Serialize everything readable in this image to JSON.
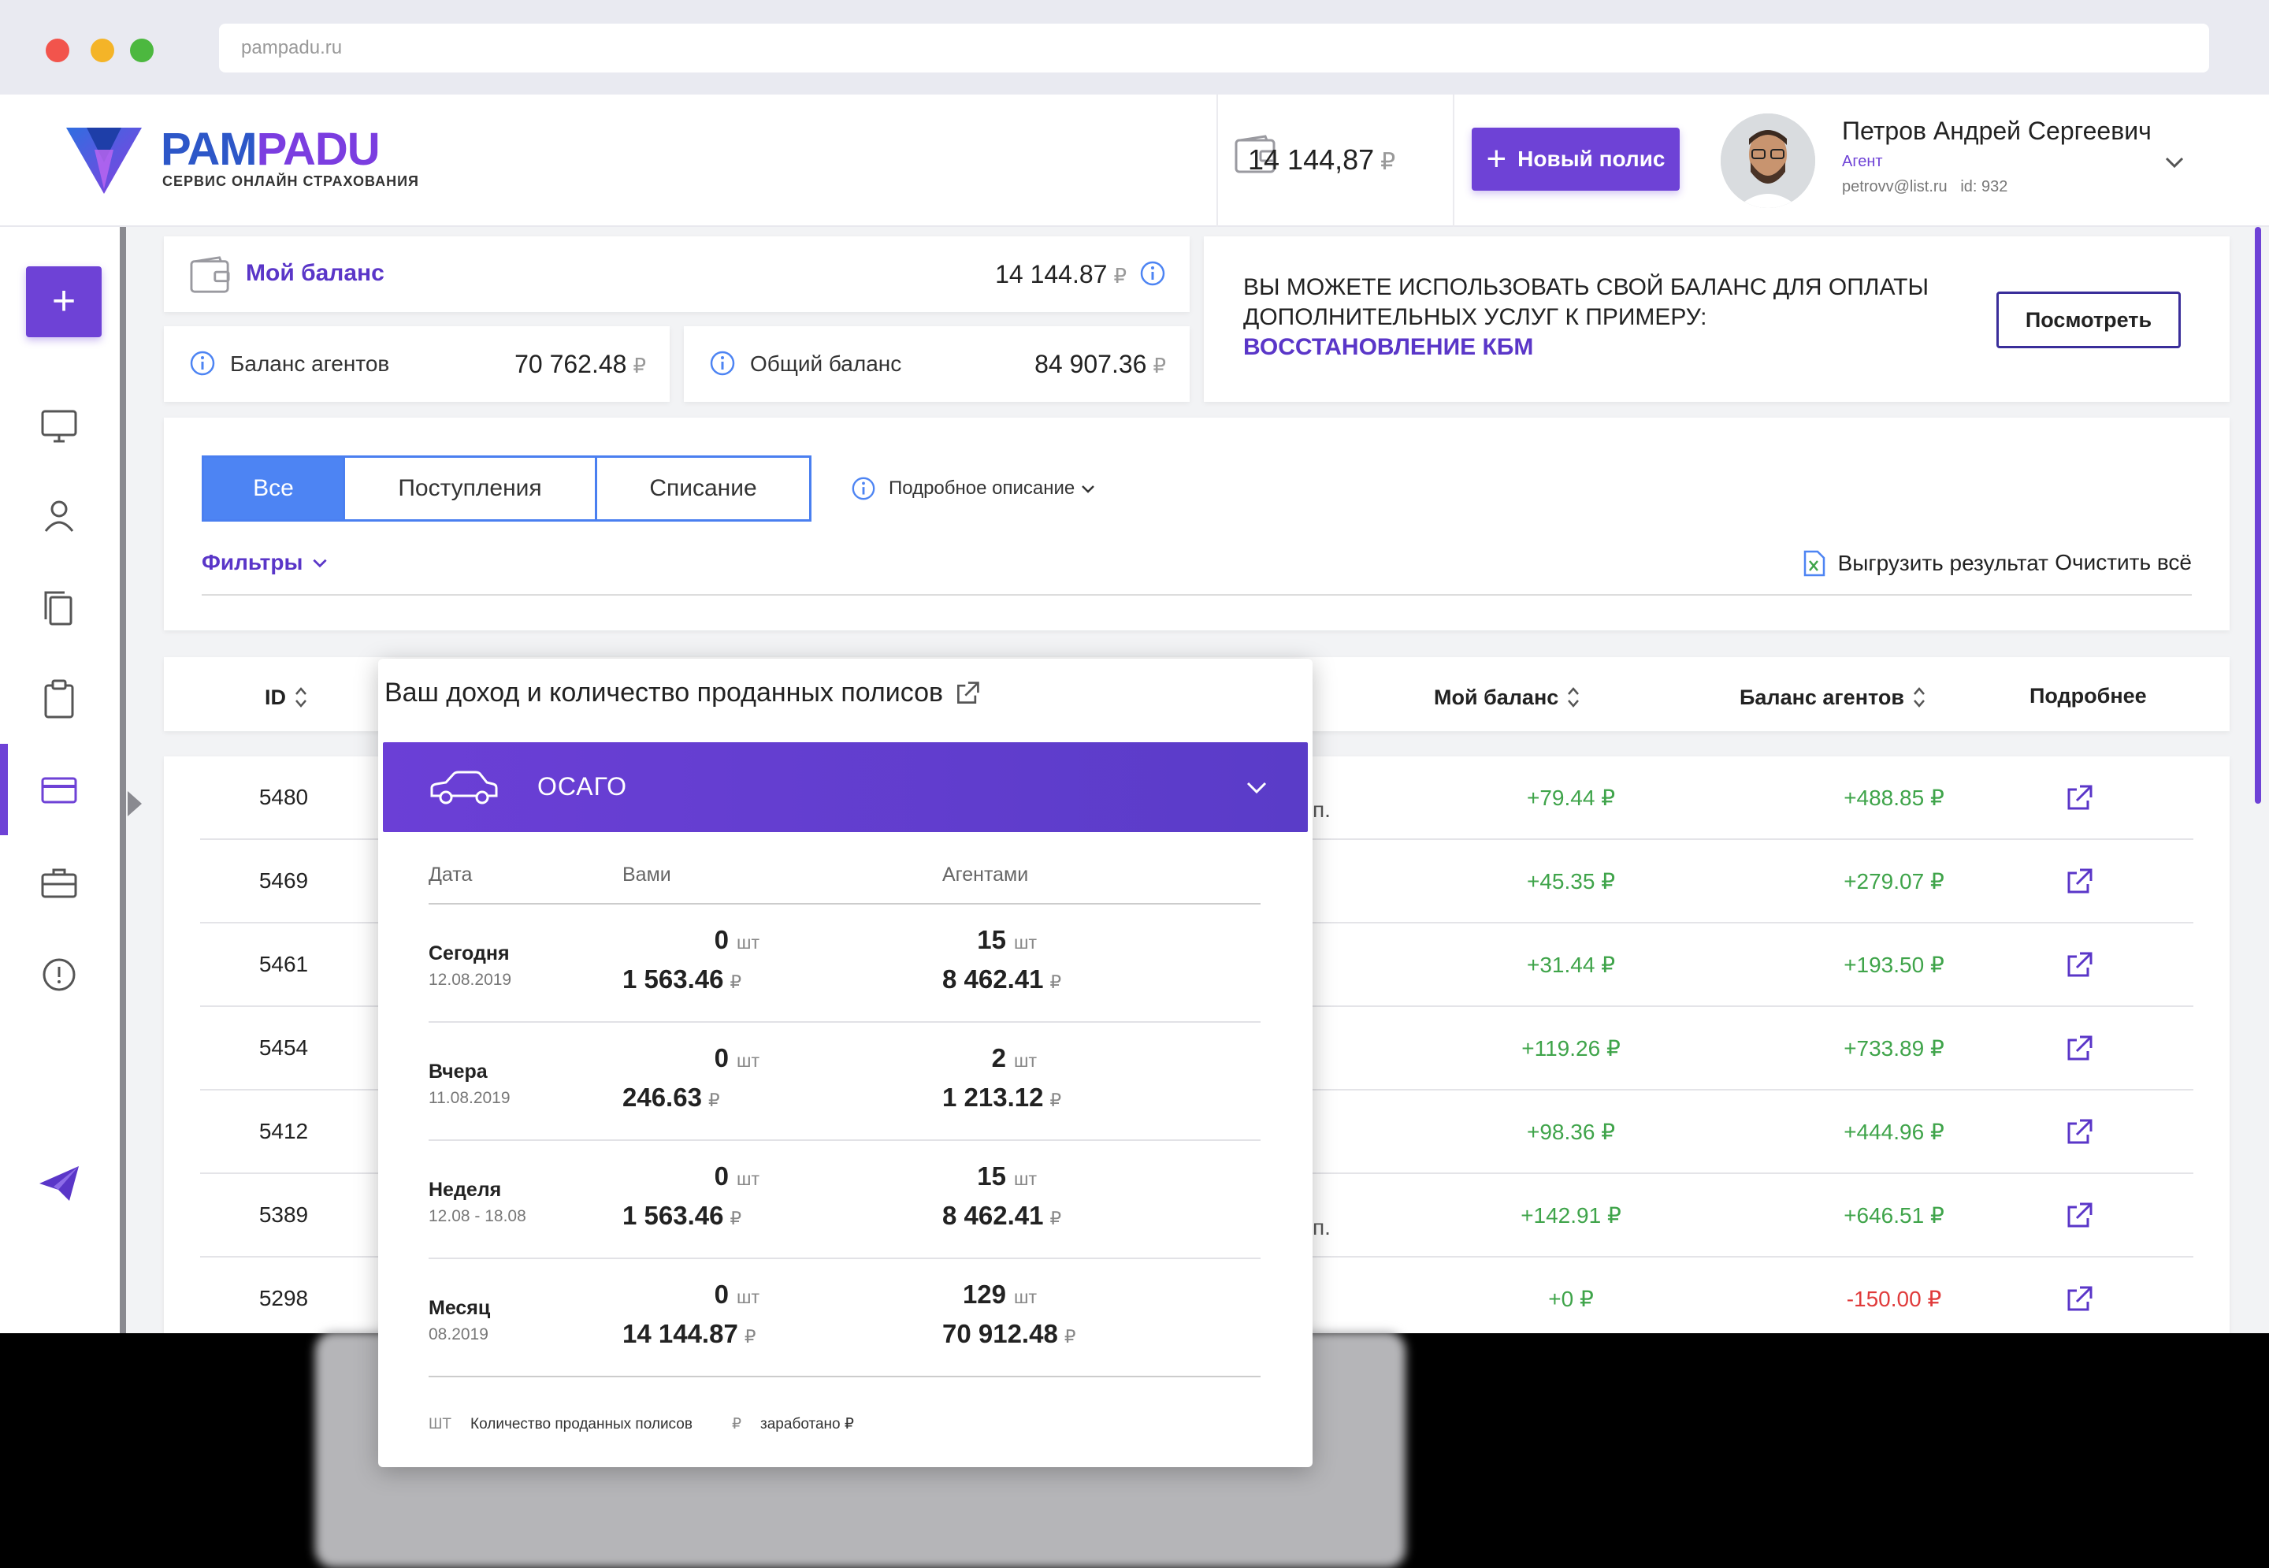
{
  "browser": {
    "url": "pampadu.ru"
  },
  "header": {
    "logo_part1": "PAM",
    "logo_part2": "PADU",
    "logo_subtitle": "СЕРВИС ОНЛАЙН СТРАХОВАНИЯ",
    "balance": "14 144,87",
    "currency": "₽",
    "new_policy_label": "Новый полис",
    "user": {
      "name": "Петров Андрей Сергеевич",
      "role": "Агент",
      "email": "petrovv@list.ru",
      "id": "id: 932"
    }
  },
  "sidebar": {
    "add_label": "+",
    "icons": [
      "monitor-icon",
      "user-icon",
      "copy-icon",
      "clipboard-icon",
      "card-icon",
      "briefcase-icon",
      "alert-icon",
      "send-icon"
    ],
    "active": "card-icon"
  },
  "balance_card": {
    "title": "Мой баланс",
    "value": "14 144.87",
    "currency": "₽"
  },
  "agents_card": {
    "label": "Баланс агентов",
    "value": "70 762.48",
    "currency": "₽"
  },
  "total_card": {
    "label": "Общий баланс",
    "value": "84 907.36",
    "currency": "₽"
  },
  "promo": {
    "text": "ВЫ МОЖЕТЕ ИСПОЛЬЗОВАТЬ СВОЙ БАЛАНС ДЛЯ ОПЛАТЫ ДОПОЛНИТЕЛЬНЫХ УСЛУГ К ПРИМЕРУ:",
    "link": "ВОССТАНОВЛЕНИЕ КБМ",
    "button": "Посмотреть"
  },
  "tabs": [
    {
      "label": "Все",
      "active": true
    },
    {
      "label": "Поступления",
      "active": false
    },
    {
      "label": "Списание",
      "active": false
    }
  ],
  "description_link": "Подробное описание",
  "filters_label": "Фильтры",
  "export_label": "Выгрузить результат",
  "clear_label": "Очистить всё",
  "table": {
    "headers": {
      "id": "ID",
      "my_balance": "Мой баланс",
      "agents_balance": "Баланс агентов",
      "details": "Подробнее"
    },
    "rows": [
      {
        "id": "5480",
        "suffix": "п.",
        "my": "+79.44",
        "agents": "+488.85",
        "agents_sign": "pos"
      },
      {
        "id": "5469",
        "suffix": "",
        "my": "+45.35",
        "agents": "+279.07",
        "agents_sign": "pos"
      },
      {
        "id": "5461",
        "suffix": "",
        "my": "+31.44",
        "agents": "+193.50",
        "agents_sign": "pos"
      },
      {
        "id": "5454",
        "suffix": "",
        "my": "+119.26",
        "agents": "+733.89",
        "agents_sign": "pos"
      },
      {
        "id": "5412",
        "suffix": "",
        "my": "+98.36",
        "agents": "+444.96",
        "agents_sign": "pos"
      },
      {
        "id": "5389",
        "suffix": "п.",
        "my": "+142.91",
        "agents": "+646.51",
        "agents_sign": "pos"
      },
      {
        "id": "5298",
        "suffix": "",
        "my": "+0",
        "agents": "-150.00",
        "agents_sign": "neg"
      }
    ],
    "currency": "₽"
  },
  "popup": {
    "title": "Ваш доход и количество проданных полисов",
    "section": "ОСАГО",
    "col_date": "Дата",
    "col_you": "Вами",
    "col_agents": "Агентами",
    "unit_count": "шт",
    "currency": "₽",
    "rows": [
      {
        "label": "Сегодня",
        "date": "12.08.2019",
        "you_count": "0",
        "you_sum": "1 563.46",
        "ag_count": "15",
        "ag_sum": "8 462.41"
      },
      {
        "label": "Вчера",
        "date": "11.08.2019",
        "you_count": "0",
        "you_sum": "246.63",
        "ag_count": "2",
        "ag_sum": "1 213.12"
      },
      {
        "label": "Неделя",
        "date": "12.08 - 18.08",
        "you_count": "0",
        "you_sum": "1 563.46",
        "ag_count": "15",
        "ag_sum": "8 462.41"
      },
      {
        "label": "Месяц",
        "date": "08.2019",
        "you_count": "0",
        "you_sum": "14 144.87",
        "ag_count": "129",
        "ag_sum": "70 912.48"
      }
    ],
    "legend_count_key": "ШТ",
    "legend_count": "Количество проданных полисов",
    "legend_sum_key": "₽",
    "legend_sum": "заработано ₽"
  }
}
